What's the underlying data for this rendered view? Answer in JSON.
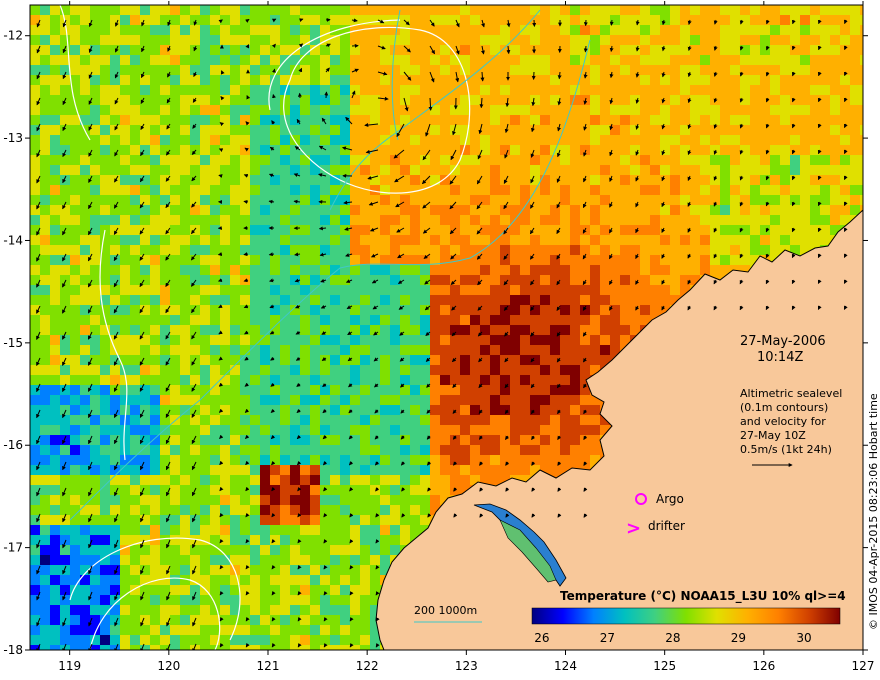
{
  "map": {
    "x_ticks": [
      "119",
      "120",
      "121",
      "122",
      "123",
      "124",
      "125",
      "126",
      "127"
    ],
    "y_ticks": [
      "-12",
      "-13",
      "-14",
      "-15",
      "-16",
      "-17",
      "-18"
    ],
    "lon_range": [
      118.6,
      127.0
    ],
    "lat_range": [
      -18.0,
      -11.7
    ],
    "date_line1": "27-May-2006",
    "date_line2": "10:14Z",
    "altimetry_lines": [
      "Altimetric sealevel",
      "(0.1m contours)",
      "and velocity for",
      "27-May 10Z",
      "0.5m/s (1kt 24h)"
    ],
    "argo_label": "Argo",
    "drifter_label": "drifter",
    "drifter_symbol": ">",
    "bathy_label": "200  1000m",
    "colorbar_title": "Temperature (°C) NOAA15_L3U 10% ql>=4",
    "colorbar_ticks": [
      "26",
      "27",
      "28",
      "29",
      "30"
    ],
    "colorbar_range": [
      25.85,
      30.55
    ],
    "credit": "© IMOS 04-Apr-2015 08:23:06 Hobart time",
    "colors": {
      "land": "#f8c89a",
      "argo": "#ff00ff",
      "drifter": "#ff00ff",
      "bathy_contour": "#40c8c8",
      "sealevel_contour": "#ffffff",
      "vector": "#000000"
    },
    "colormap": [
      "#000080",
      "#0000ff",
      "#0080ff",
      "#00c0c0",
      "#40d080",
      "#80e000",
      "#e0e000",
      "#ffb000",
      "#ff8000",
      "#d04000",
      "#800000"
    ]
  }
}
